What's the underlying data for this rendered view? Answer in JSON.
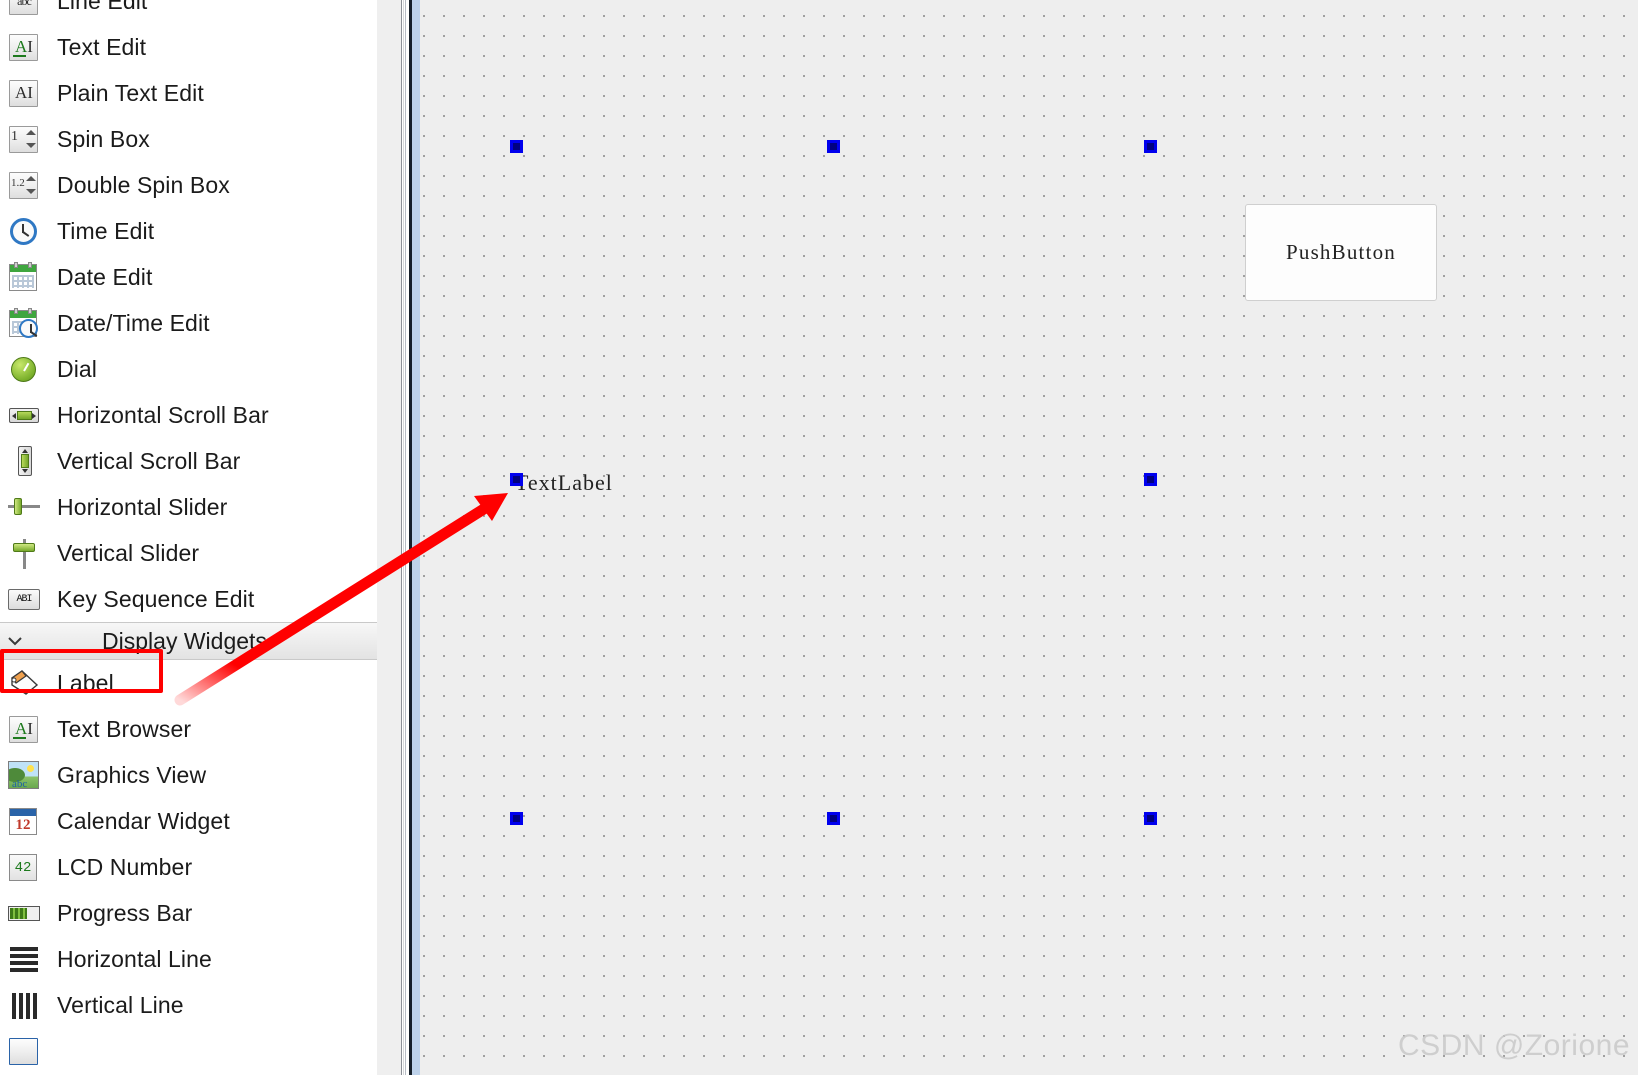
{
  "widget_box": {
    "items": [
      {
        "label": "Line Edit",
        "icon": "line-edit-icon",
        "partial": true
      },
      {
        "label": "Text Edit",
        "icon": "text-edit-icon"
      },
      {
        "label": "Plain Text Edit",
        "icon": "plain-text-edit-icon"
      },
      {
        "label": "Spin Box",
        "icon": "spin-box-icon",
        "icon_text": "1"
      },
      {
        "label": "Double Spin Box",
        "icon": "double-spin-box-icon",
        "icon_text": "1.2"
      },
      {
        "label": "Time Edit",
        "icon": "time-edit-clock-icon"
      },
      {
        "label": "Date Edit",
        "icon": "date-edit-calendar-icon"
      },
      {
        "label": "Date/Time Edit",
        "icon": "date-time-edit-icon"
      },
      {
        "label": "Dial",
        "icon": "dial-icon"
      },
      {
        "label": "Horizontal Scroll Bar",
        "icon": "horizontal-scroll-bar-icon"
      },
      {
        "label": "Vertical Scroll Bar",
        "icon": "vertical-scroll-bar-icon"
      },
      {
        "label": "Horizontal Slider",
        "icon": "horizontal-slider-icon"
      },
      {
        "label": "Vertical Slider",
        "icon": "vertical-slider-icon"
      },
      {
        "label": "Key Sequence Edit",
        "icon": "key-sequence-edit-icon",
        "icon_text": "ABI"
      }
    ],
    "section": {
      "title": "Display Widgets",
      "chevron": "chevron-down-icon",
      "expanded": true
    },
    "display_items": [
      {
        "label": "Label",
        "icon": "label-tag-icon",
        "highlighted": true
      },
      {
        "label": "Text Browser",
        "icon": "text-browser-icon"
      },
      {
        "label": "Graphics View",
        "icon": "graphics-view-icon"
      },
      {
        "label": "Calendar Widget",
        "icon": "calendar-widget-icon",
        "icon_text": "12"
      },
      {
        "label": "LCD Number",
        "icon": "lcd-number-icon",
        "icon_text": "42"
      },
      {
        "label": "Progress Bar",
        "icon": "progress-bar-icon"
      },
      {
        "label": "Horizontal Line",
        "icon": "horizontal-line-icon"
      },
      {
        "label": "Vertical Line",
        "icon": "vertical-line-icon"
      }
    ]
  },
  "canvas": {
    "push_button_label": "PushButton",
    "text_label": "TextLabel",
    "watermark": "CSDN @Zorione"
  },
  "colors": {
    "highlight_red": "#ff0000",
    "handle_fill": "#000080",
    "handle_border": "#0000ee",
    "canvas_bg": "#eeeeee",
    "grid_dot": "#9a9a9a",
    "scrollbar_thumb": "#808080",
    "blue_strip": "#bed2ea"
  },
  "annotation": {
    "arrow_color": "#ff0000",
    "arrow_from": "label-item",
    "arrow_to": "text-label-on-form"
  }
}
